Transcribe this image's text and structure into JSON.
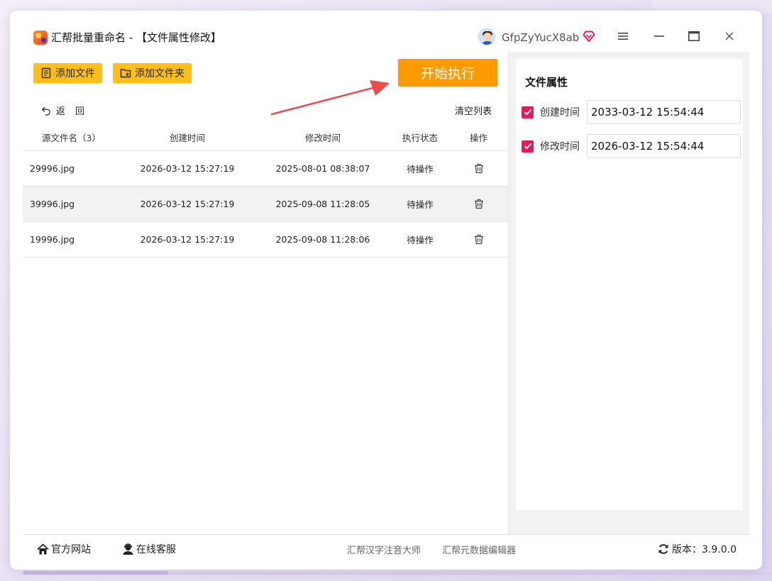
{
  "window": {
    "title": "汇帮批量重命名 - 【文件属性修改】",
    "username": "GfpZyYucX8ab"
  },
  "toolbar": {
    "add_file_label": "添加文件",
    "add_folder_label": "添加文件夹",
    "start_label": "开始执行",
    "back_label": "返回",
    "clear_label": "清空列表"
  },
  "table": {
    "headers": [
      "源文件名（3）",
      "创建时间",
      "修改时间",
      "执行状态",
      "操作"
    ],
    "rows": [
      {
        "name": "29996.jpg",
        "created": "2026-03-12 15:27:19",
        "modified": "2025-08-01 08:38:07",
        "status": "待操作"
      },
      {
        "name": "39996.jpg",
        "created": "2026-03-12 15:27:19",
        "modified": "2025-09-08 11:28:05",
        "status": "待操作"
      },
      {
        "name": "19996.jpg",
        "created": "2026-03-12 15:27:19",
        "modified": "2025-09-08 11:28:06",
        "status": "待操作"
      }
    ]
  },
  "props": {
    "title": "文件属性",
    "created_label": "创建时间",
    "created_value": "2033-03-12 15:54:44",
    "created_checked": true,
    "modified_label": "修改时间",
    "modified_value": "2026-03-12 15:54:44",
    "modified_checked": true
  },
  "footer": {
    "home_label": "官方网站",
    "service_label": "在线客服",
    "link1": "汇帮汉字注音大师",
    "link2": "汇帮元数据编辑器",
    "version_label": "版本：3.9.0.0"
  },
  "colors": {
    "accent_yellow": "#ffbf17",
    "accent_orange": "#ff9a00",
    "checkbox_pink": "#e8185a",
    "arrow_red": "#ee4a4a"
  },
  "icons": {
    "add_file": "document-list-icon",
    "add_folder": "folder-plus-icon",
    "back": "undo-arrow-icon",
    "delete": "trash-icon",
    "home": "home-icon",
    "service": "headset-user-icon",
    "version": "refresh-icon",
    "vip": "diamond-heart-icon"
  }
}
